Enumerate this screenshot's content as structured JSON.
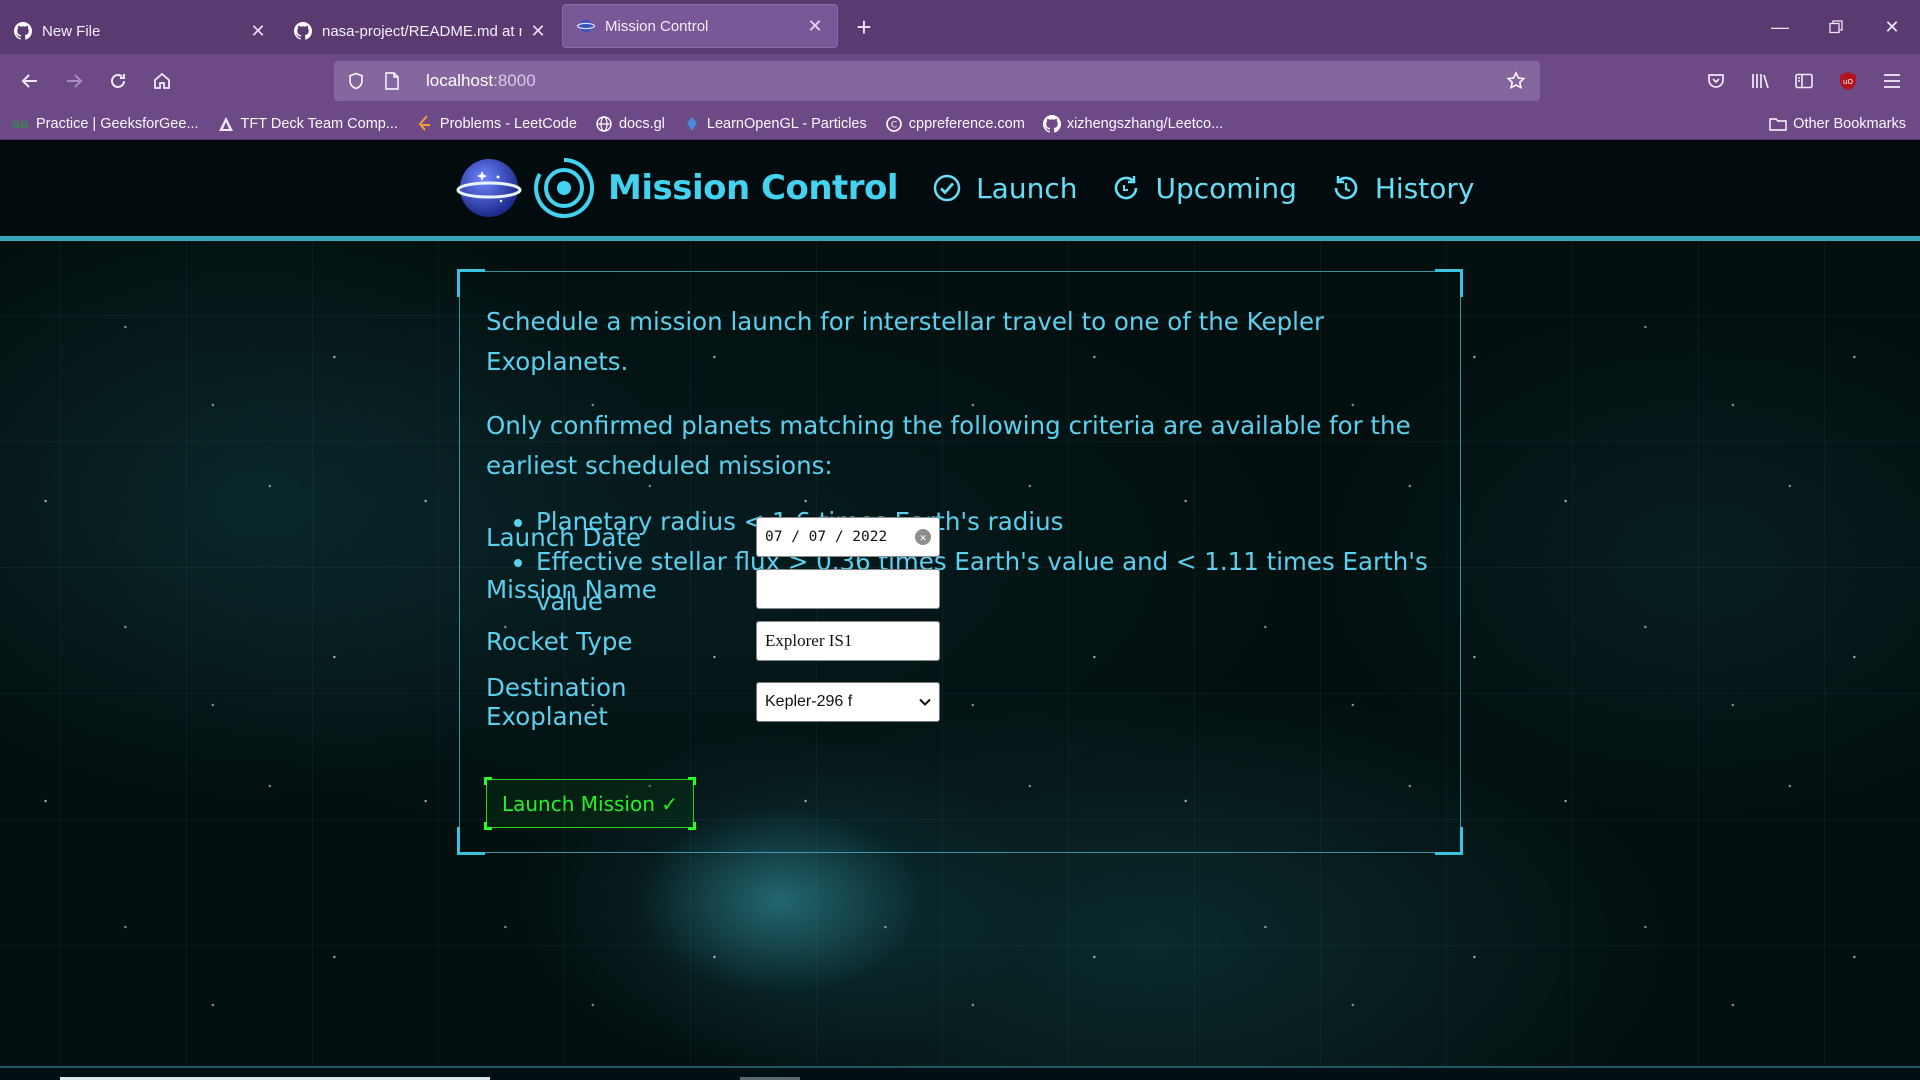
{
  "browser": {
    "tabs": [
      {
        "title": "New File",
        "icon": "github-icon"
      },
      {
        "title": "nasa-project/README.md at m",
        "icon": "github-icon"
      },
      {
        "title": "Mission Control",
        "icon": "planet-icon"
      }
    ],
    "url_host": "localhost",
    "url_port": ":8000",
    "bookmarks": [
      {
        "label": "Practice | GeeksforGee..."
      },
      {
        "label": "TFT Deck Team Comp..."
      },
      {
        "label": "Problems - LeetCode"
      },
      {
        "label": "docs.gl"
      },
      {
        "label": "LearnOpenGL - Particles"
      },
      {
        "label": "cppreference.com"
      },
      {
        "label": "xizhengszhang/Leetco..."
      }
    ],
    "other_bookmarks": "Other Bookmarks"
  },
  "app": {
    "title": "Mission Control",
    "nav": [
      {
        "label": "Launch",
        "icon": "check-circle-icon"
      },
      {
        "label": "Upcoming",
        "icon": "refresh-icon"
      },
      {
        "label": "History",
        "icon": "history-icon"
      }
    ],
    "accent_color": "#43d3f0",
    "button_color": "#25f02d"
  },
  "launch_form": {
    "intro": "Schedule a mission launch for interstellar travel to one of the Kepler Exoplanets.",
    "criteria_intro": "Only confirmed planets matching the following criteria are available for the earliest scheduled missions:",
    "criteria": [
      "Planetary radius < 1.6 times Earth's radius",
      "Effective stellar flux > 0.36 times Earth's value and < 1.11 times Earth's value"
    ],
    "fields": {
      "launch_date": {
        "label": "Launch Date",
        "value": "07 / 07 / 2022"
      },
      "mission_name": {
        "label": "Mission Name",
        "value": ""
      },
      "rocket_type": {
        "label": "Rocket Type",
        "value": "Explorer IS1"
      },
      "destination": {
        "label": "Destination Exoplanet",
        "value": "Kepler-296 f"
      }
    },
    "submit_label": "Launch Mission ✓"
  }
}
